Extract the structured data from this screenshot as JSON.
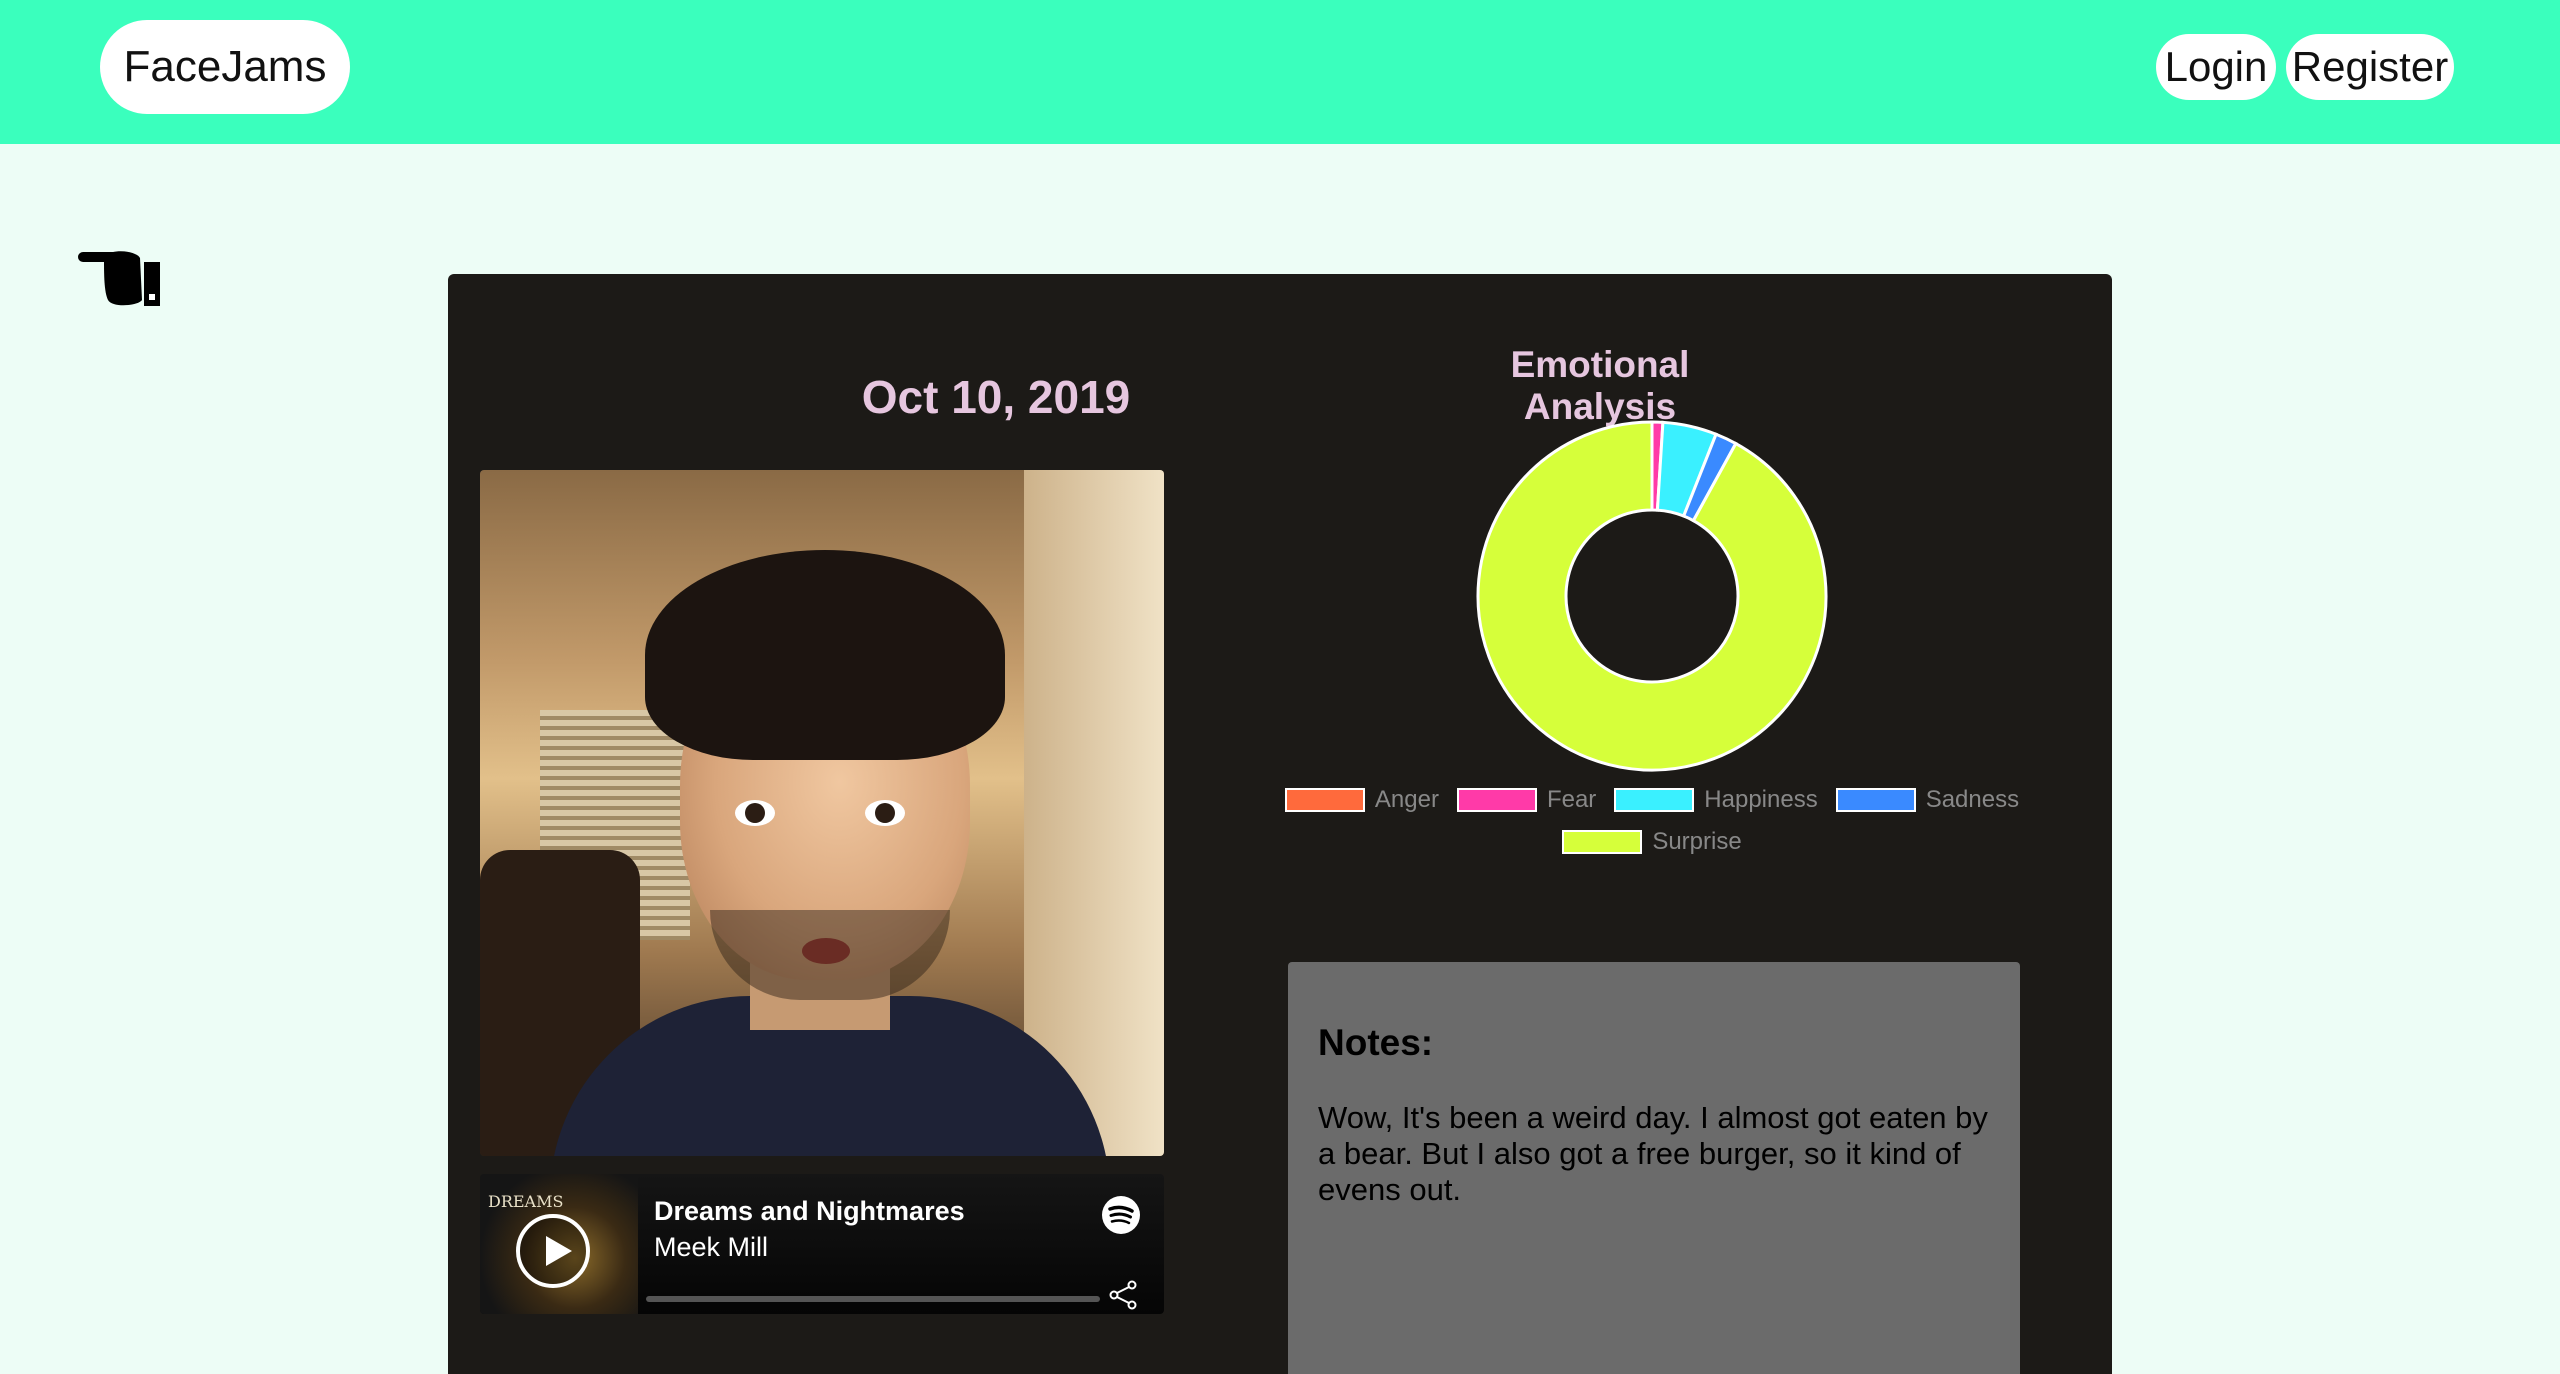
{
  "navbar": {
    "brand": "FaceJams",
    "login_label": "Login",
    "register_label": "Register",
    "color": "#3affbd"
  },
  "back_icon": "pointing-hand-icon",
  "entry": {
    "date": "Oct 10, 2019",
    "photo_alt": "surprised-face-selfie"
  },
  "player": {
    "album_art_text": "DREAMS",
    "track_title": "Dreams and Nightmares",
    "artist": "Meek Mill",
    "icons": [
      "play-icon",
      "spotify-icon",
      "share-icon"
    ],
    "progress": 0
  },
  "chart_data": {
    "type": "pie",
    "title": "Emotional Analysis",
    "hole": true,
    "categories": [
      "Anger",
      "Fear",
      "Happiness",
      "Sadness",
      "Surprise"
    ],
    "values": [
      0,
      0.01,
      0.05,
      0.02,
      0.92
    ],
    "colors": [
      "#ff6a3c",
      "#ff3aa8",
      "#3af0ff",
      "#3a8aff",
      "#d6ff3a"
    ],
    "legend": "bottom"
  },
  "notes": {
    "heading": "Notes:",
    "body": "Wow, It's been a weird day. I almost got eaten by a bear. But I also got a free burger, so it kind of evens out."
  }
}
